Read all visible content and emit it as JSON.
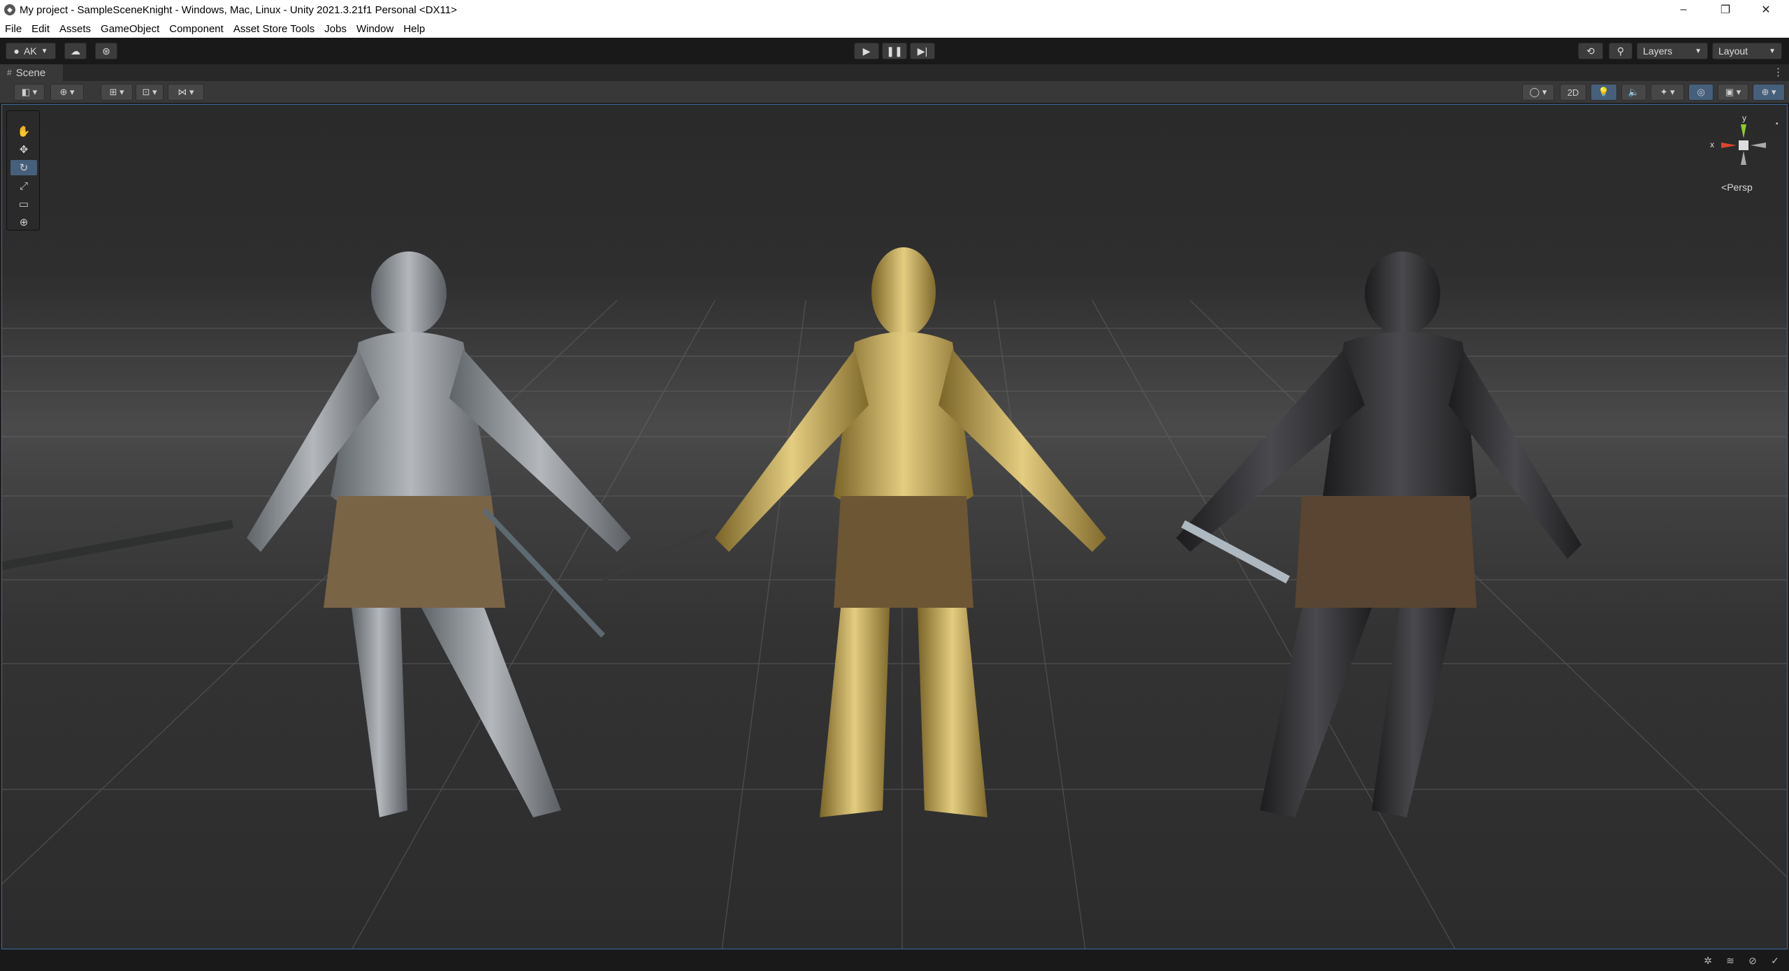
{
  "window": {
    "title": "My project - SampleSceneKnight - Windows, Mac, Linux - Unity 2021.3.21f1 Personal <DX11>",
    "controls": {
      "minimize": "–",
      "restore": "❐",
      "close": "✕"
    }
  },
  "menu": [
    "File",
    "Edit",
    "Assets",
    "GameObject",
    "Component",
    "Asset Store Tools",
    "Jobs",
    "Window",
    "Help"
  ],
  "toolbar": {
    "account": "AK",
    "layers": "Layers",
    "layout": "Layout",
    "play_icon": "play-icon",
    "pause_icon": "pause-icon",
    "step_icon": "step-icon"
  },
  "scene_tab": {
    "label": "Scene"
  },
  "scene_toolbar": {
    "mode_2d": "2D"
  },
  "gizmo": {
    "axis_y": "y",
    "axis_x": "x",
    "projection": "Persp",
    "colors": {
      "x": "#e0442c",
      "y": "#8fcb2c",
      "z": "#3a7be0"
    }
  },
  "scene": {
    "knights": [
      "silver-knight",
      "gold-knight",
      "dark-knight"
    ]
  },
  "colors": {
    "accent": "#3a6aa0",
    "active_tool": "#46607c"
  }
}
